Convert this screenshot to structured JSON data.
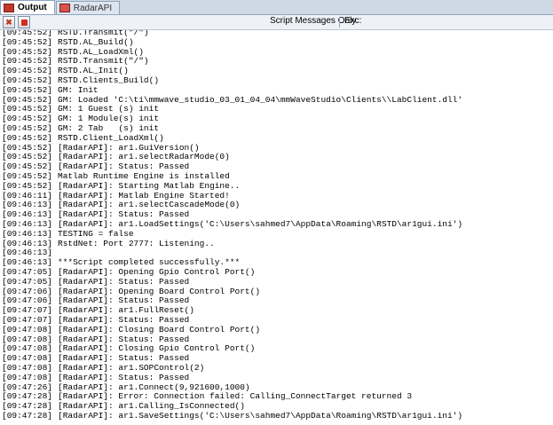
{
  "tabs": [
    {
      "label": "Output",
      "active": true,
      "icon": "output-window-icon"
    },
    {
      "label": "RadarAPI",
      "active": false,
      "icon": "radar-api-icon"
    }
  ],
  "toolbar": {
    "filter_label": "Script Messages Only",
    "exc_label": "Exc:"
  },
  "colors": {
    "normal": "#000000",
    "warning": "#d8901a",
    "info": "#2ea34a",
    "error": "#d12b2b"
  },
  "log": [
    {
      "time": "[09:45:52]",
      "text": "RSTD.Transmit(\"/\")",
      "type": "normal"
    },
    {
      "time": "[09:45:52]",
      "text": "RSTD.AL_Build()",
      "type": "normal"
    },
    {
      "time": "[09:45:52]",
      "text": "RSTD.AL_LoadXml()",
      "type": "normal"
    },
    {
      "time": "[09:45:52]",
      "text": "RSTD.Transmit(\"/\")",
      "type": "normal"
    },
    {
      "time": "[09:45:52]",
      "text": "RSTD.AL_Init()",
      "type": "normal"
    },
    {
      "time": "[09:45:52]",
      "text": "RSTD.Clients_Build()",
      "type": "normal"
    },
    {
      "time": "[09:45:52]",
      "text": "GM: Init",
      "type": "normal"
    },
    {
      "time": "[09:45:52]",
      "text": "GM: Loaded 'C:\\ti\\mmwave_studio_03_01_04_04\\mmWaveStudio\\Clients\\\\LabClient.dll'",
      "type": "normal"
    },
    {
      "time": "[09:45:52]",
      "text": "GM: 1 Guest (s) init",
      "type": "normal"
    },
    {
      "time": "[09:45:52]",
      "text": "GM: 1 Module(s) init",
      "type": "normal"
    },
    {
      "time": "[09:45:52]",
      "text": "GM: 2 Tab   (s) init",
      "type": "normal"
    },
    {
      "time": "[09:45:52]",
      "text": "RSTD.Client_LoadXml()",
      "type": "normal"
    },
    {
      "time": "[09:45:52]",
      "text": "[RadarAPI]: ar1.GuiVersion()",
      "type": "normal"
    },
    {
      "time": "[09:45:52]",
      "text": "[RadarAPI]: ar1.selectRadarMode(0)",
      "type": "normal"
    },
    {
      "time": "[09:45:52]",
      "text": "[RadarAPI]: Status: Passed",
      "type": "normal"
    },
    {
      "time": "[09:45:52]",
      "text": "Matlab Runtime Engine is installed",
      "type": "warning"
    },
    {
      "time": "[09:45:52]",
      "text": "[RadarAPI]: Starting Matlab Engine..",
      "type": "normal"
    },
    {
      "time": "[09:46:11]",
      "text": "[RadarAPI]: Matlab Engine Started!",
      "type": "normal"
    },
    {
      "time": "[09:46:13]",
      "text": "[RadarAPI]: ar1.selectCascadeMode(0)",
      "type": "normal"
    },
    {
      "time": "[09:46:13]",
      "text": "[RadarAPI]: Status: Passed",
      "type": "normal"
    },
    {
      "time": "[09:46:13]",
      "text": "[RadarAPI]: ar1.LoadSettings('C:\\Users\\sahmed7\\AppData\\Roaming\\RSTD\\ar1gui.ini')",
      "type": "normal"
    },
    {
      "time": "[09:46:13]",
      "text": "TESTING = false",
      "type": "info"
    },
    {
      "time": "[09:46:13]",
      "text": "RstdNet: Port 2777: Listening..",
      "type": "normal"
    },
    {
      "time": "[09:46:13]",
      "text": "",
      "type": "normal"
    },
    {
      "time": "[09:46:13]",
      "text": "***Script completed successfully.***",
      "type": "normal"
    },
    {
      "time": "[09:47:05]",
      "text": "[RadarAPI]: Opening Gpio Control Port()",
      "type": "normal"
    },
    {
      "time": "[09:47:05]",
      "text": "[RadarAPI]: Status: Passed",
      "type": "normal"
    },
    {
      "time": "[09:47:06]",
      "text": "[RadarAPI]: Opening Board Control Port()",
      "type": "normal"
    },
    {
      "time": "[09:47:06]",
      "text": "[RadarAPI]: Status: Passed",
      "type": "normal"
    },
    {
      "time": "[09:47:07]",
      "text": "[RadarAPI]: ar1.FullReset()",
      "type": "normal"
    },
    {
      "time": "[09:47:07]",
      "text": "[RadarAPI]: Status: Passed",
      "type": "normal"
    },
    {
      "time": "[09:47:08]",
      "text": "[RadarAPI]: Closing Board Control Port()",
      "type": "normal"
    },
    {
      "time": "[09:47:08]",
      "text": "[RadarAPI]: Status: Passed",
      "type": "normal"
    },
    {
      "time": "[09:47:08]",
      "text": "[RadarAPI]: Closing Gpio Control Port()",
      "type": "normal"
    },
    {
      "time": "[09:47:08]",
      "text": "[RadarAPI]: Status: Passed",
      "type": "normal"
    },
    {
      "time": "[09:47:08]",
      "text": "[RadarAPI]: ar1.SOPControl(2)",
      "type": "normal"
    },
    {
      "time": "[09:47:08]",
      "text": "[RadarAPI]: Status: Passed",
      "type": "normal"
    },
    {
      "time": "[09:47:26]",
      "text": "[RadarAPI]: ar1.Connect(9,921600,1000)",
      "type": "normal"
    },
    {
      "time": "[09:47:28]",
      "text": "[RadarAPI]: Error: Connection failed: Calling_ConnectTarget returned 3",
      "type": "error"
    },
    {
      "time": "[09:47:28]",
      "text": "[RadarAPI]: ar1.Calling_IsConnected()",
      "type": "normal"
    },
    {
      "time": "[09:47:28]",
      "text": "[RadarAPI]: ar1.SaveSettings('C:\\Users\\sahmed7\\AppData\\Roaming\\RSTD\\ar1gui.ini')",
      "type": "normal"
    }
  ]
}
